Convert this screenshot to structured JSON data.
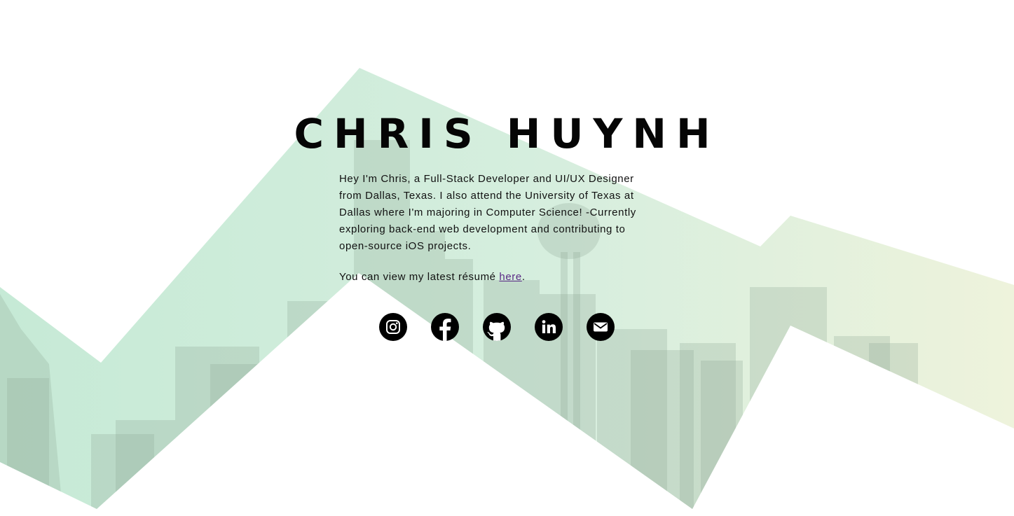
{
  "header": {
    "name": "CHRIS HUYNH"
  },
  "bio": {
    "text": "Hey I'm Chris, a Full-Stack Developer and UI/UX Designer from Dallas, Texas. I also attend the University of Texas at Dallas where I'm majoring in Computer Science! -Currently exploring back-end web development and contributing to open-source iOS projects."
  },
  "resume": {
    "prefix": "You can view my latest résumé ",
    "link_label": "here",
    "suffix": "."
  },
  "social": [
    {
      "icon": "instagram-icon"
    },
    {
      "icon": "facebook-icon"
    },
    {
      "icon": "github-icon"
    },
    {
      "icon": "linkedin-icon"
    },
    {
      "icon": "email-icon"
    }
  ],
  "colors": {
    "mint": "#c4ead4",
    "mint_light": "#dcf4e4",
    "link": "#5a2a86",
    "text": "#111111"
  }
}
